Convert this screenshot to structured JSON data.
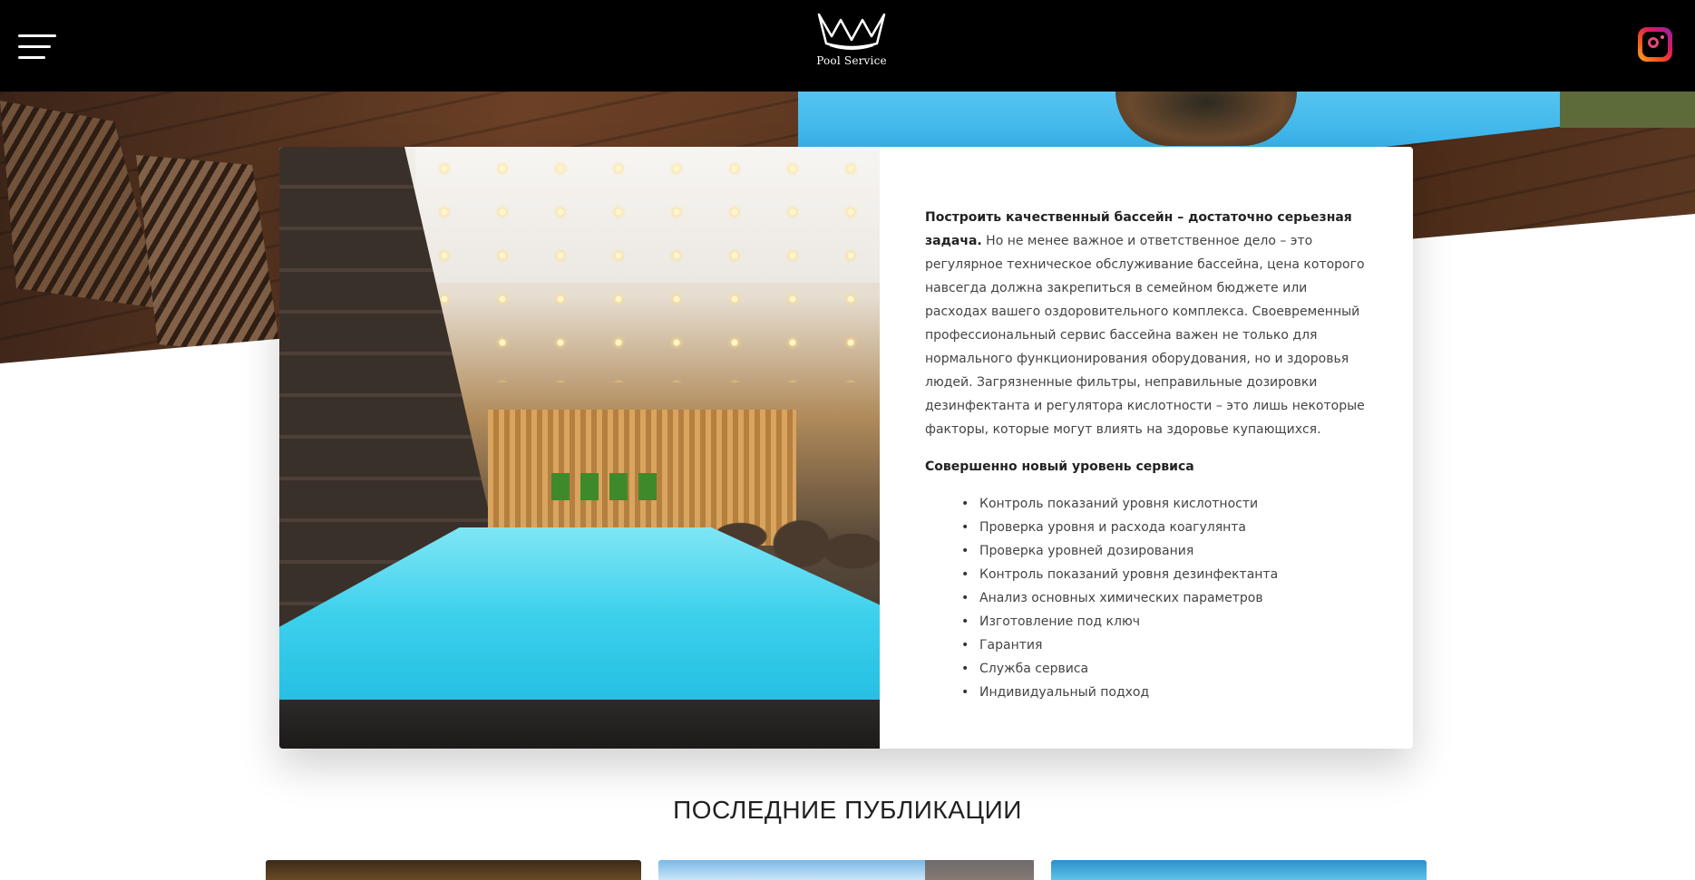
{
  "header": {
    "logo_text": "Pool Service",
    "menu_icon": "hamburger-menu-icon",
    "social_icon": "instagram-icon"
  },
  "about": {
    "intro_bold": "Построить качественный бассейн – достаточно серьезная задача.",
    "intro_rest": " Но не менее важное и ответственное дело – это регулярное техническое обслуживание бассейна, цена которого навсегда должна закрепиться в семейном бюджете или расходах вашего оздоровительного комплекса. Своевременный профессиональный сервис бассейна важен не только для нормального функционирования оборудования, но и здоровья людей. Загрязненные фильтры, неправильные дозировки дезинфектанта и регулятора кислотности – это лишь некоторые факторы, которые могут влиять на здоровье купающихся.",
    "subheading": "Совершенно новый уровень сервиса",
    "services": [
      "Контроль показаний уровня кислотности",
      "Проверка уровня и расхода коагулянта",
      "Проверка уровней дозирования",
      "Контроль показаний уровня дезинфектанта",
      "Анализ основных химических параметров",
      "Изготовление под ключ",
      "Гарантия",
      "Служба сервиса",
      "Индивидуальный подход"
    ]
  },
  "publications": {
    "title": "ПОСЛЕДНИЕ ПУБЛИКАЦИИ"
  },
  "colors": {
    "header_bg": "#000000",
    "text": "#444444",
    "pool_accent": "#19b6dd"
  }
}
